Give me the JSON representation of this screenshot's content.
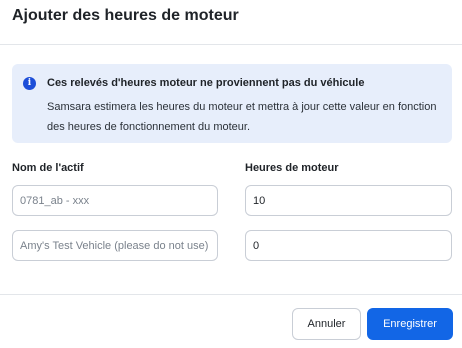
{
  "dialog": {
    "title": "Ajouter des heures de moteur"
  },
  "banner": {
    "icon": "info-icon",
    "icon_glyph": "i",
    "title": "Ces relevés d'heures moteur ne proviennent pas du véhicule",
    "text": "Samsara estimera les heures du moteur et mettra à jour cette valeur en fonction des heures de fonctionnement du moteur."
  },
  "table": {
    "headers": {
      "asset": "Nom de l'actif",
      "hours": "Heures de moteur"
    },
    "rows": [
      {
        "asset": "0781_ab - xxx",
        "hours": "10"
      },
      {
        "asset": "Amy's Test Vehicle (please do not use)",
        "hours": "0"
      }
    ]
  },
  "footer": {
    "cancel_label": "Annuler",
    "save_label": "Enregistrer"
  },
  "colors": {
    "primary": "#1266e6",
    "banner_bg": "#e7eefb",
    "info_icon": "#1d4ed8"
  }
}
